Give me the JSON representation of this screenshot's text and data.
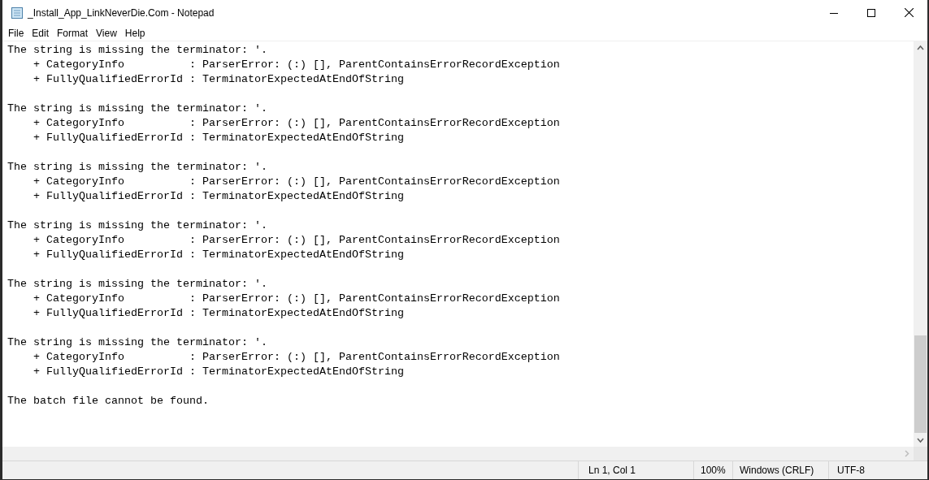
{
  "window": {
    "title": "_Install_App_LinkNeverDie.Com - Notepad"
  },
  "menu": [
    "File",
    "Edit",
    "Format",
    "View",
    "Help"
  ],
  "editor": {
    "blocks": [
      {
        "message": "The string is missing the terminator: '.",
        "details": [
          "    + CategoryInfo          : ParserError: (:) [], ParentContainsErrorRecordException",
          "    + FullyQualifiedErrorId : TerminatorExpectedAtEndOfString"
        ]
      },
      {
        "message": "The string is missing the terminator: '.",
        "details": [
          "    + CategoryInfo          : ParserError: (:) [], ParentContainsErrorRecordException",
          "    + FullyQualifiedErrorId : TerminatorExpectedAtEndOfString"
        ]
      },
      {
        "message": "The string is missing the terminator: '.",
        "details": [
          "    + CategoryInfo          : ParserError: (:) [], ParentContainsErrorRecordException",
          "    + FullyQualifiedErrorId : TerminatorExpectedAtEndOfString"
        ]
      },
      {
        "message": "The string is missing the terminator: '.",
        "details": [
          "    + CategoryInfo          : ParserError: (:) [], ParentContainsErrorRecordException",
          "    + FullyQualifiedErrorId : TerminatorExpectedAtEndOfString"
        ]
      },
      {
        "message": "The string is missing the terminator: '.",
        "details": [
          "    + CategoryInfo          : ParserError: (:) [], ParentContainsErrorRecordException",
          "    + FullyQualifiedErrorId : TerminatorExpectedAtEndOfString"
        ]
      },
      {
        "message": "The string is missing the terminator: '.",
        "details": [
          "    + CategoryInfo          : ParserError: (:) [], ParentContainsErrorRecordException",
          "    + FullyQualifiedErrorId : TerminatorExpectedAtEndOfString"
        ]
      },
      {
        "message": "The batch file cannot be found."
      }
    ]
  },
  "status_bar": {
    "position": "Ln 1, Col 1",
    "zoom": "100%",
    "line_ending": "Windows (CRLF)",
    "encoding": "UTF-8"
  }
}
